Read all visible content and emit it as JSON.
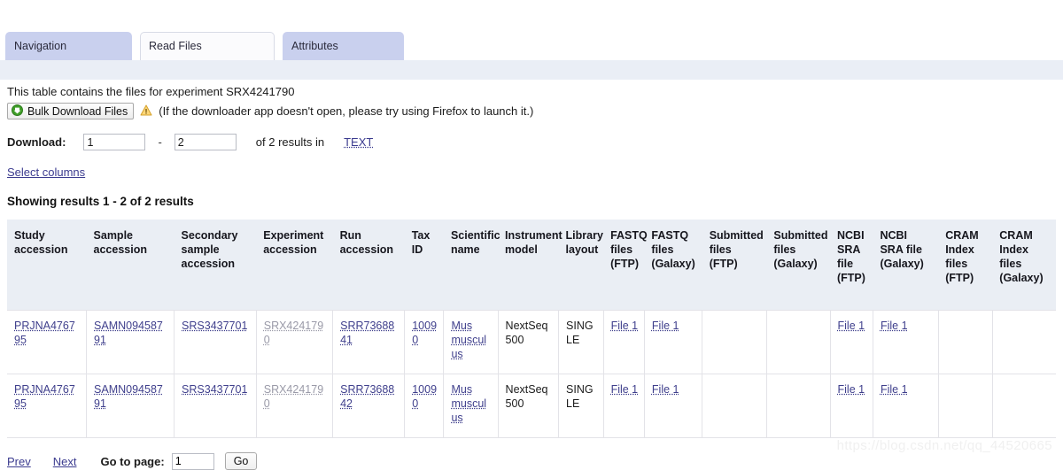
{
  "tabs": [
    {
      "label": "Navigation",
      "active": false
    },
    {
      "label": "Read Files",
      "active": true
    },
    {
      "label": "Attributes",
      "active": false
    }
  ],
  "intro": {
    "text": "This table contains the files for experiment SRX4241790",
    "bulk_download_label": "Bulk Download Files",
    "download_note": "(If the downloader app doesn't open, please try using Firefox to launch it.)"
  },
  "download_bar": {
    "label": "Download:",
    "from_value": "1",
    "separator": "-",
    "to_value": "2",
    "results_text": "of 2 results in",
    "format_link": "TEXT"
  },
  "select_columns_link": "Select columns",
  "showing_results": "Showing results 1 - 2 of 2 results",
  "table": {
    "columns": [
      "Study accession",
      "Sample accession",
      "Secondary sample accession",
      "Experiment accession",
      "Run accession",
      "Tax ID",
      "Scientific name",
      "Instrument model",
      "Library layout",
      "FASTQ files (FTP)",
      "FASTQ files (Galaxy)",
      "Submitted files (FTP)",
      "Submitted files (Galaxy)",
      "NCBI SRA file (FTP)",
      "NCBI SRA file (Galaxy)",
      "CRAM Index files (FTP)",
      "CRAM Index files (Galaxy)"
    ],
    "rows": [
      {
        "study_accession": "PRJNA476795",
        "sample_accession": "SAMN09458791",
        "secondary_sample_accession": "SRS3437701",
        "experiment_accession": "SRX4241790",
        "run_accession": "SRR7368841",
        "tax_id": "10090",
        "scientific_name": "Mus musculus",
        "instrument_model": "NextSeq 500",
        "library_layout": "SINGLE",
        "fastq_ftp": "File 1",
        "fastq_galaxy": "File 1",
        "submitted_ftp": "",
        "submitted_galaxy": "",
        "ncbi_sra_ftp": "File 1",
        "ncbi_sra_galaxy": "File 1",
        "cram_index_ftp": "",
        "cram_index_galaxy": ""
      },
      {
        "study_accession": "PRJNA476795",
        "sample_accession": "SAMN09458791",
        "secondary_sample_accession": "SRS3437701",
        "experiment_accession": "SRX4241790",
        "run_accession": "SRR7368842",
        "tax_id": "10090",
        "scientific_name": "Mus musculus",
        "instrument_model": "NextSeq 500",
        "library_layout": "SINGLE",
        "fastq_ftp": "File 1",
        "fastq_galaxy": "File 1",
        "submitted_ftp": "",
        "submitted_galaxy": "",
        "ncbi_sra_ftp": "File 1",
        "ncbi_sra_galaxy": "File 1",
        "cram_index_ftp": "",
        "cram_index_galaxy": ""
      }
    ]
  },
  "pager": {
    "prev": "Prev",
    "next": "Next",
    "goto_label": "Go to page:",
    "page_value": "1",
    "go_label": "Go"
  },
  "watermark": "https://blog.csdn.net/qq_44520665",
  "colors": {
    "tab_inactive": "#c9d0ee",
    "tab_active": "#fbfbfd",
    "subbar": "#eaeef6",
    "table_header": "#eaeef4",
    "link": "#3f3f8c",
    "muted_link": "#9a9aa8",
    "download_icon_green": "#3f9e28"
  }
}
